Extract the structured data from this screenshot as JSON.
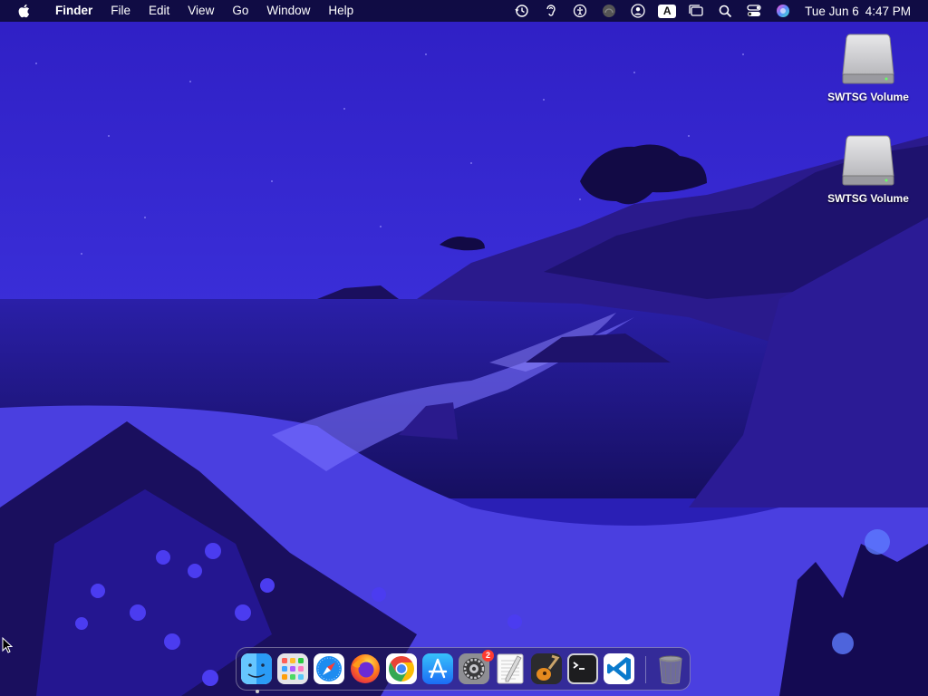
{
  "menubar": {
    "apple_icon": "apple-logo-icon",
    "menus": [
      "Finder",
      "File",
      "Edit",
      "View",
      "Go",
      "Window",
      "Help"
    ],
    "status_icons": [
      "time-machine-icon",
      "hearing-icon",
      "accessibility-icon",
      "screen-mirroring-icon",
      "user-icon"
    ],
    "input_source": "A",
    "status_icons_right": [
      "stage-manager-icon",
      "spotlight-search-icon",
      "control-center-icon",
      "siri-icon"
    ],
    "clock": {
      "date": "Tue Jun 6",
      "time": "4:47 PM"
    }
  },
  "desktop": {
    "icons": [
      {
        "label": "SWTSG Volume",
        "icon": "hard-drive-icon"
      },
      {
        "label": "SWTSG Volume",
        "icon": "hard-drive-icon"
      }
    ]
  },
  "dock": {
    "apps": [
      {
        "name": "Finder",
        "icon": "finder-icon",
        "running": true
      },
      {
        "name": "Launchpad",
        "icon": "launchpad-icon"
      },
      {
        "name": "Safari",
        "icon": "safari-icon"
      },
      {
        "name": "Firefox",
        "icon": "firefox-icon"
      },
      {
        "name": "Google Chrome",
        "icon": "chrome-icon"
      },
      {
        "name": "App Store",
        "icon": "app-store-icon"
      },
      {
        "name": "System Settings",
        "icon": "system-settings-icon",
        "badge": "2"
      },
      {
        "name": "TextEdit",
        "icon": "textedit-icon"
      },
      {
        "name": "GarageBand",
        "icon": "garageband-icon"
      },
      {
        "name": "Terminal",
        "icon": "terminal-icon"
      },
      {
        "name": "Visual Studio Code",
        "icon": "vscode-icon"
      },
      {
        "name": "Trash",
        "icon": "trash-icon"
      }
    ]
  },
  "colors": {
    "sky": "#2e20c0",
    "sea": "#1f167f",
    "sand": "#5d55f0",
    "cliffs": "#1c1066"
  }
}
